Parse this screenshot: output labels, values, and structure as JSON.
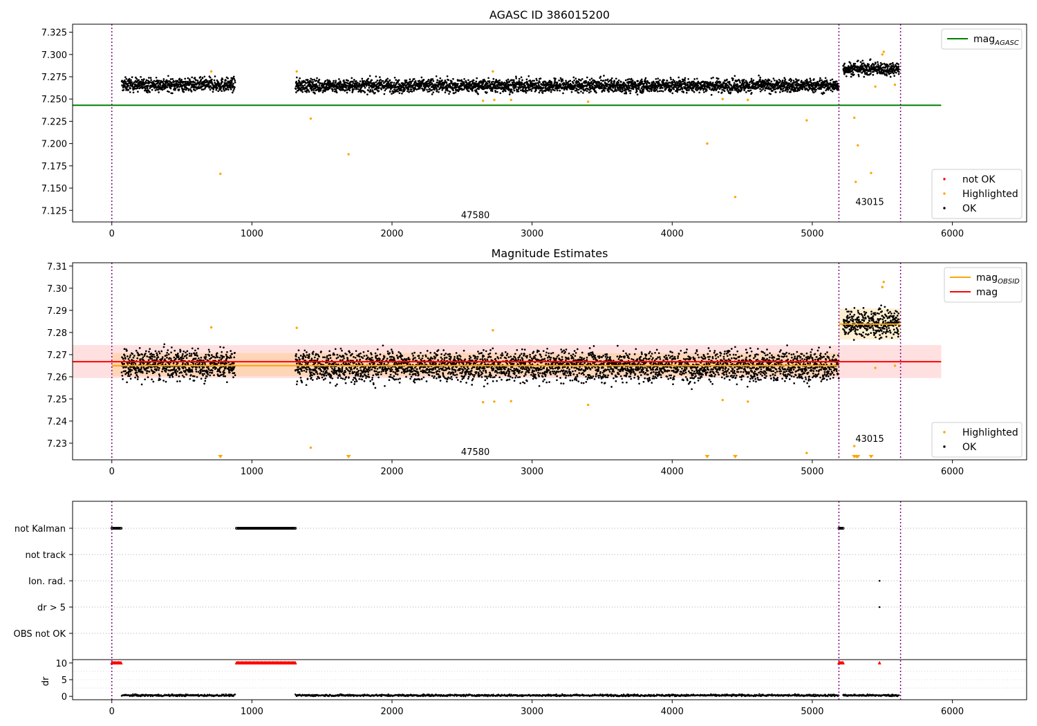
{
  "chart_data": [
    {
      "type": "scatter",
      "title": "AGASC ID 386015200",
      "xlim": [
        -280,
        6530
      ],
      "ylim": [
        7.112,
        7.334
      ],
      "xticks": [
        0,
        1000,
        2000,
        3000,
        4000,
        5000,
        6000
      ],
      "yticks": [
        7.125,
        7.15,
        7.175,
        7.2,
        7.225,
        7.25,
        7.275,
        7.3,
        7.325
      ],
      "ytick_labels": [
        "7.125",
        "7.150",
        "7.175",
        "7.200",
        "7.225",
        "7.250",
        "7.275",
        "7.300",
        "7.325"
      ],
      "grid": false,
      "observation_boundaries": [
        0,
        5190,
        5630
      ],
      "observation_labels": [
        {
          "text": "47580",
          "x": 2595,
          "y": 7.12
        },
        {
          "text": "43015",
          "x": 5410,
          "y": 7.135
        }
      ],
      "reference_line": {
        "name": "mag_AGASC",
        "y": 7.243,
        "x": [
          -280,
          5920
        ],
        "color": "#008000"
      },
      "ok_segments": [
        {
          "x": [
            70,
            880
          ],
          "center": 7.266,
          "spread": 0.006
        },
        {
          "x": [
            1310,
            5190
          ],
          "center": 7.265,
          "spread": 0.006
        },
        {
          "x": [
            5220,
            5620
          ],
          "center": 7.284,
          "spread": 0.006
        }
      ],
      "highlighted_points": [
        {
          "x": 710,
          "y": 7.281
        },
        {
          "x": 775,
          "y": 7.166
        },
        {
          "x": 1320,
          "y": 7.281
        },
        {
          "x": 1420,
          "y": 7.228
        },
        {
          "x": 1690,
          "y": 7.188
        },
        {
          "x": 2650,
          "y": 7.248
        },
        {
          "x": 2720,
          "y": 7.281
        },
        {
          "x": 2730,
          "y": 7.249
        },
        {
          "x": 2850,
          "y": 7.249
        },
        {
          "x": 3400,
          "y": 7.247
        },
        {
          "x": 4250,
          "y": 7.2
        },
        {
          "x": 4360,
          "y": 7.25
        },
        {
          "x": 4450,
          "y": 7.14
        },
        {
          "x": 4540,
          "y": 7.249
        },
        {
          "x": 4960,
          "y": 7.226
        },
        {
          "x": 5300,
          "y": 7.229
        },
        {
          "x": 5310,
          "y": 7.157
        },
        {
          "x": 5325,
          "y": 7.198
        },
        {
          "x": 5420,
          "y": 7.167
        },
        {
          "x": 5450,
          "y": 7.264
        },
        {
          "x": 5500,
          "y": 7.3
        },
        {
          "x": 5510,
          "y": 7.303
        },
        {
          "x": 5590,
          "y": 7.266
        }
      ],
      "legends": [
        {
          "placement": "upper right",
          "entries": [
            {
              "label": "mag",
              "subscript": "AGASC",
              "kind": "line",
              "color": "#008000"
            }
          ]
        },
        {
          "placement": "lower right",
          "entries": [
            {
              "label": "not OK",
              "kind": "point",
              "color": "#ff0000"
            },
            {
              "label": "Highlighted",
              "kind": "point",
              "color": "#ffa500"
            },
            {
              "label": "OK",
              "kind": "point",
              "color": "#000000"
            }
          ]
        }
      ]
    },
    {
      "type": "scatter",
      "title": "Magnitude Estimates",
      "xlim": [
        -280,
        6530
      ],
      "ylim": [
        7.2225,
        7.3115
      ],
      "xticks": [
        0,
        1000,
        2000,
        3000,
        4000,
        5000,
        6000
      ],
      "yticks": [
        7.23,
        7.24,
        7.25,
        7.26,
        7.27,
        7.28,
        7.29,
        7.3,
        7.31
      ],
      "ytick_labels": [
        "7.23",
        "7.24",
        "7.25",
        "7.26",
        "7.27",
        "7.28",
        "7.29",
        "7.30",
        "7.31"
      ],
      "grid": false,
      "observation_boundaries": [
        0,
        5190,
        5630
      ],
      "observation_labels": [
        {
          "text": "47580",
          "x": 2595,
          "y": 7.2262
        },
        {
          "text": "43015",
          "x": 5410,
          "y": 7.2322
        }
      ],
      "mag": {
        "name": "mag",
        "y": 7.2668,
        "band": [
          7.2594,
          7.2743
        ],
        "x": [
          -280,
          5920
        ],
        "color": "#ff0000"
      },
      "mag_obsid": [
        {
          "y": 7.265,
          "x": [
            0,
            5190
          ],
          "band": [
            7.2603,
            7.2707
          ]
        },
        {
          "y": 7.2838,
          "x": [
            5190,
            5630
          ],
          "band": [
            7.2768,
            7.2908
          ]
        }
      ],
      "ok_segments": [
        {
          "x": [
            70,
            880
          ],
          "center": 7.2655,
          "spread": 0.0055
        },
        {
          "x": [
            1310,
            5190
          ],
          "center": 7.2648,
          "spread": 0.0055
        },
        {
          "x": [
            5220,
            5620
          ],
          "center": 7.284,
          "spread": 0.0048
        }
      ],
      "highlighted_points": [
        {
          "x": 710,
          "y": 7.2823
        },
        {
          "x": 1320,
          "y": 7.2821
        },
        {
          "x": 1420,
          "y": 7.228
        },
        {
          "x": 2650,
          "y": 7.2485
        },
        {
          "x": 2720,
          "y": 7.281
        },
        {
          "x": 2730,
          "y": 7.2488
        },
        {
          "x": 2850,
          "y": 7.249
        },
        {
          "x": 3400,
          "y": 7.2473
        },
        {
          "x": 4360,
          "y": 7.2495
        },
        {
          "x": 4540,
          "y": 7.2488
        },
        {
          "x": 4960,
          "y": 7.2256
        },
        {
          "x": 5300,
          "y": 7.2287
        },
        {
          "x": 5450,
          "y": 7.264
        },
        {
          "x": 5500,
          "y": 7.3005
        },
        {
          "x": 5510,
          "y": 7.3028
        },
        {
          "x": 5590,
          "y": 7.265
        }
      ],
      "clipped_low_markers": [
        775,
        1690,
        4250,
        4450,
        5300,
        5315,
        5325,
        5420
      ],
      "legends": [
        {
          "placement": "upper right",
          "entries": [
            {
              "label": "mag",
              "subscript": "OBSID",
              "kind": "line",
              "color": "#ffa500"
            },
            {
              "label": "mag",
              "kind": "line",
              "color": "#ff0000"
            }
          ]
        },
        {
          "placement": "lower right",
          "entries": [
            {
              "label": "Highlighted",
              "kind": "point",
              "color": "#ffa500"
            },
            {
              "label": "OK",
              "kind": "point",
              "color": "#000000"
            }
          ]
        }
      ]
    },
    {
      "type": "scatter",
      "xlim": [
        -280,
        6530
      ],
      "xticks": [
        0,
        1000,
        2000,
        3000,
        4000,
        5000,
        6000
      ],
      "observation_boundaries": [
        0,
        5190,
        5630
      ],
      "flag_rows": [
        "not Kalman",
        "not track",
        "Ion. rad.",
        "dr > 5",
        "OBS not OK"
      ],
      "flag_intervals": {
        "not Kalman": [
          [
            0,
            70
          ],
          [
            890,
            1310
          ],
          [
            5190,
            5220
          ]
        ],
        "not track": [],
        "Ion. rad.": [
          [
            5480,
            5480
          ]
        ],
        "dr > 5": [
          [
            5480,
            5480
          ]
        ],
        "OBS not OK": []
      },
      "dr_axis": {
        "ylabel": "dr",
        "ylim": [
          -1,
          11
        ],
        "yticks": [
          0,
          5,
          10
        ],
        "clipped_intervals": [
          [
            0,
            70
          ],
          [
            890,
            1310
          ],
          [
            5190,
            5220
          ],
          [
            5480,
            5480
          ]
        ],
        "baseline": 0.3
      }
    }
  ]
}
